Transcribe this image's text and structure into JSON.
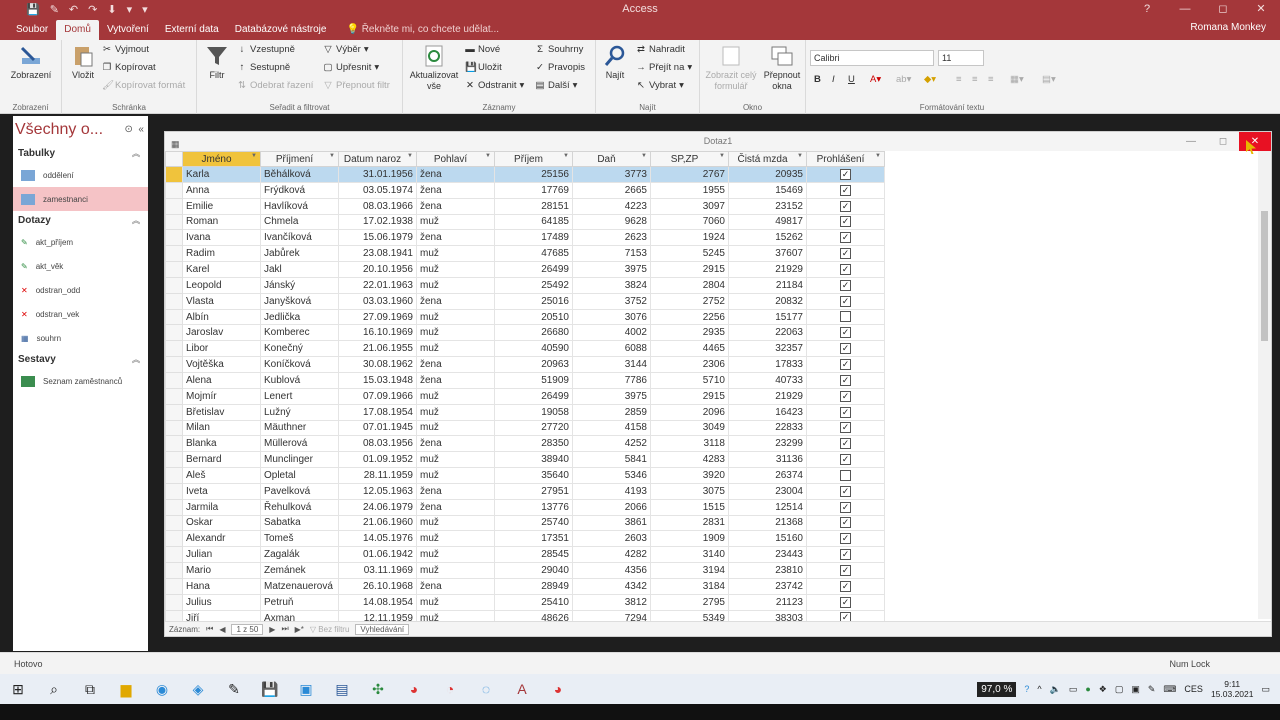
{
  "app": {
    "title": "Access",
    "user": "Romana Monkey"
  },
  "qat": [
    "💾",
    "✎",
    "↶",
    "↷",
    "⬇",
    "▾",
    "▾"
  ],
  "window_controls": [
    "?",
    "—",
    "◻",
    "✕"
  ],
  "tabs": {
    "file": "Soubor",
    "home": "Domů",
    "create": "Vytvoření",
    "external": "Externí data",
    "dbtools": "Databázové nástroje",
    "tellme": "Řekněte mi, co chcete udělat..."
  },
  "ribbon": {
    "views": {
      "label": "Zobrazení",
      "group": "Zobrazení"
    },
    "clipboard": {
      "paste": "Vložit",
      "cut": "Vyjmout",
      "copy": "Kopírovat",
      "format": "Kopírovat formát",
      "group": "Schránka"
    },
    "sort": {
      "filter": "Filtr",
      "asc": "Vzestupně",
      "desc": "Sestupně",
      "clear": "Odebrat řazení",
      "selection": "Výběr",
      "advanced": "Upřesnit",
      "toggle": "Přepnout filtr",
      "group": "Seřadit a filtrovat"
    },
    "records": {
      "refresh": "Aktualizovat vše",
      "new": "Nové",
      "save": "Uložit",
      "delete": "Odstranit",
      "totals": "Souhrny",
      "spelling": "Pravopis",
      "more": "Další",
      "group": "Záznamy"
    },
    "find": {
      "find": "Najít",
      "replace": "Nahradit",
      "goto": "Přejít na",
      "select": "Vybrat",
      "group": "Najít"
    },
    "window": {
      "fit": "Zobrazit celý formulář",
      "switch": "Přepnout okna",
      "group": "Okno"
    },
    "text": {
      "font": "Calibri",
      "size": "11",
      "group": "Formátování textu"
    }
  },
  "nav": {
    "title": "Všechny o...",
    "sections": {
      "tables": "Tabulky",
      "queries": "Dotazy",
      "reports": "Sestavy"
    },
    "tables": [
      "oddělení",
      "zamestnanci"
    ],
    "queries": [
      "akt_příjem",
      "akt_věk",
      "odstran_odd",
      "odstran_vek",
      "souhrn"
    ],
    "reports": [
      "Seznam zaměstnanců"
    ]
  },
  "query": {
    "title": "Dotaz1",
    "columns": [
      "Jméno",
      "Příjmení",
      "Datum naroz",
      "Pohlaví",
      "Příjem",
      "Daň",
      "SP,ZP",
      "Čistá mzda",
      "Prohlášení"
    ],
    "rows": [
      [
        "Karla",
        "Běhálková",
        "31.01.1956",
        "žena",
        "25156",
        "3773",
        "2767",
        "20935",
        "1"
      ],
      [
        "Anna",
        "Frýdková",
        "03.05.1974",
        "žena",
        "17769",
        "2665",
        "1955",
        "15469",
        "1"
      ],
      [
        "Emilie",
        "Havlíková",
        "08.03.1966",
        "žena",
        "28151",
        "4223",
        "3097",
        "23152",
        "1"
      ],
      [
        "Roman",
        "Chmela",
        "17.02.1938",
        "muž",
        "64185",
        "9628",
        "7060",
        "49817",
        "1"
      ],
      [
        "Ivana",
        "Ivančíková",
        "15.06.1979",
        "žena",
        "17489",
        "2623",
        "1924",
        "15262",
        "1"
      ],
      [
        "Radim",
        "Jabůrek",
        "23.08.1941",
        "muž",
        "47685",
        "7153",
        "5245",
        "37607",
        "1"
      ],
      [
        "Karel",
        "Jakl",
        "20.10.1956",
        "muž",
        "26499",
        "3975",
        "2915",
        "21929",
        "1"
      ],
      [
        "Leopold",
        "Jánský",
        "22.01.1963",
        "muž",
        "25492",
        "3824",
        "2804",
        "21184",
        "1"
      ],
      [
        "Vlasta",
        "Janyšková",
        "03.03.1960",
        "žena",
        "25016",
        "3752",
        "2752",
        "20832",
        "1"
      ],
      [
        "Albín",
        "Jedlička",
        "27.09.1969",
        "muž",
        "20510",
        "3076",
        "2256",
        "15177",
        "0"
      ],
      [
        "Jaroslav",
        "Komberec",
        "16.10.1969",
        "muž",
        "26680",
        "4002",
        "2935",
        "22063",
        "1"
      ],
      [
        "Libor",
        "Konečný",
        "21.06.1955",
        "muž",
        "40590",
        "6088",
        "4465",
        "32357",
        "1"
      ],
      [
        "Vojtěška",
        "Koníčková",
        "30.08.1962",
        "žena",
        "20963",
        "3144",
        "2306",
        "17833",
        "1"
      ],
      [
        "Alena",
        "Kublová",
        "15.03.1948",
        "žena",
        "51909",
        "7786",
        "5710",
        "40733",
        "1"
      ],
      [
        "Mojmír",
        "Lenert",
        "07.09.1966",
        "muž",
        "26499",
        "3975",
        "2915",
        "21929",
        "1"
      ],
      [
        "Břetislav",
        "Lužný",
        "17.08.1954",
        "muž",
        "19058",
        "2859",
        "2096",
        "16423",
        "1"
      ],
      [
        "Milan",
        "Mäuthner",
        "07.01.1945",
        "muž",
        "27720",
        "4158",
        "3049",
        "22833",
        "1"
      ],
      [
        "Blanka",
        "Müllerová",
        "08.03.1956",
        "žena",
        "28350",
        "4252",
        "3118",
        "23299",
        "1"
      ],
      [
        "Bernard",
        "Munclinger",
        "01.09.1952",
        "muž",
        "38940",
        "5841",
        "4283",
        "31136",
        "1"
      ],
      [
        "Aleš",
        "Opletal",
        "28.11.1959",
        "muž",
        "35640",
        "5346",
        "3920",
        "26374",
        "0"
      ],
      [
        "Iveta",
        "Pavelková",
        "12.05.1963",
        "žena",
        "27951",
        "4193",
        "3075",
        "23004",
        "1"
      ],
      [
        "Jarmila",
        "Řehulková",
        "24.06.1979",
        "žena",
        "13776",
        "2066",
        "1515",
        "12514",
        "1"
      ],
      [
        "Oskar",
        "Sabatka",
        "21.06.1960",
        "muž",
        "25740",
        "3861",
        "2831",
        "21368",
        "1"
      ],
      [
        "Alexandr",
        "Tomeš",
        "14.05.1976",
        "muž",
        "17351",
        "2603",
        "1909",
        "15160",
        "1"
      ],
      [
        "Julian",
        "Zagalák",
        "01.06.1942",
        "muž",
        "28545",
        "4282",
        "3140",
        "23443",
        "1"
      ],
      [
        "Mario",
        "Zemánek",
        "03.11.1969",
        "muž",
        "29040",
        "4356",
        "3194",
        "23810",
        "1"
      ],
      [
        "Hana",
        "Matzenauerová",
        "26.10.1968",
        "žena",
        "28949",
        "4342",
        "3184",
        "23742",
        "1"
      ],
      [
        "Julius",
        "Petruň",
        "14.08.1954",
        "muž",
        "25410",
        "3812",
        "2795",
        "21123",
        "1"
      ],
      [
        "Jiří",
        "Axman",
        "12.11.1959",
        "muž",
        "48626",
        "7294",
        "5349",
        "38303",
        "1"
      ]
    ],
    "record_nav": {
      "label": "Záznam:",
      "pos": "1 z 50",
      "filter": "Bez filtru",
      "search": "Vyhledávání"
    }
  },
  "status": {
    "left": "Hotovo",
    "right": "Num Lock"
  },
  "taskbar": {
    "zoom": "97,0 %",
    "lang": "CES",
    "time": "9:11",
    "date": "15.03.2021"
  }
}
